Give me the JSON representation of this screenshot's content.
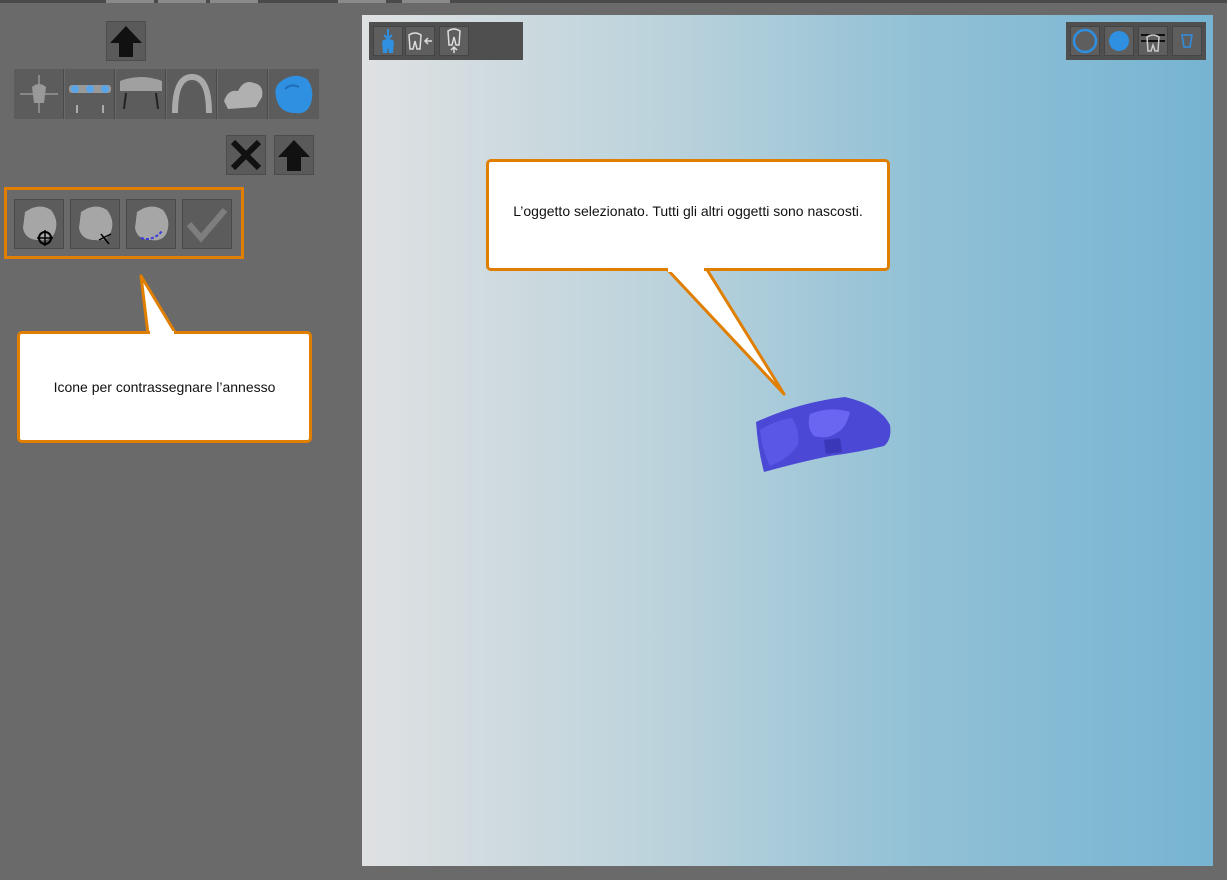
{
  "callouts": {
    "attachment_icons": "Icone per contrassegnare l’annesso",
    "selected_object": "L’oggetto selezionato. Tutti gli altri oggetti sono nascosti."
  },
  "left_panel": {
    "up_button_icon": "arrow-up-icon",
    "wizard_icons": [
      "axes-setup-icon",
      "bridge-icon",
      "abutments-icon",
      "arch-icon",
      "crowns-icon",
      "attachment-model-icon"
    ],
    "active_wizard_index": 5,
    "cancel_icon": "x-icon",
    "tools": [
      "attachment-target-icon",
      "attachment-move-icon",
      "attachment-lasso-icon",
      "confirm-check-icon"
    ]
  },
  "viewport_toolbar_left": [
    "tooth-down-icon",
    "tooth-arrow-left-icon",
    "tooth-up-icon"
  ],
  "viewport_toolbar_right": [
    "ring-icon",
    "filled-circle-icon",
    "cross-section-icon",
    "cup-icon"
  ],
  "colors": {
    "panel_bg": "#6a6a6a",
    "highlight": "#e07e00",
    "active_blue": "#2f8fe0",
    "object_blue": "#4b48d6"
  }
}
